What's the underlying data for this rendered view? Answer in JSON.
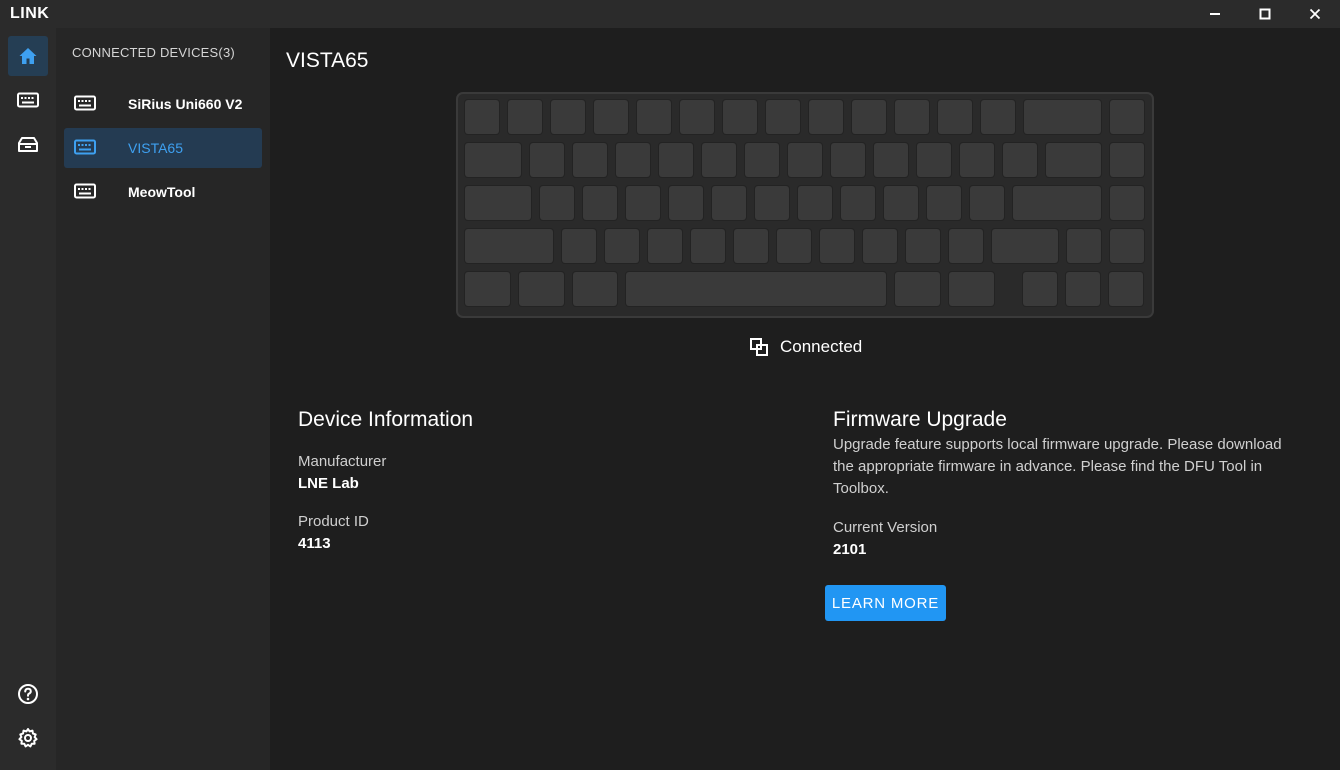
{
  "app": {
    "title": "LINK",
    "window_controls": [
      "minimize-icon",
      "maximize-icon",
      "close-icon"
    ]
  },
  "rail": {
    "top_items": [
      {
        "icon": "home-icon",
        "active": true
      },
      {
        "icon": "keyboard-icon",
        "active": false
      },
      {
        "icon": "toolbox-icon",
        "active": false
      }
    ],
    "bottom_items": [
      {
        "icon": "help-icon"
      },
      {
        "icon": "settings-gear-icon"
      }
    ]
  },
  "devices": {
    "header": "CONNECTED DEVICES(3)",
    "items": [
      {
        "label": "SiRius Uni660 V2",
        "icon": "keyboard-icon",
        "selected": false
      },
      {
        "label": "VISTA65",
        "icon": "keyboard-icon",
        "selected": true
      },
      {
        "label": "MeowTool",
        "icon": "keyboard-icon",
        "selected": false
      }
    ]
  },
  "main": {
    "device_title": "VISTA65",
    "status": {
      "icon": "connected-icon",
      "text": "Connected"
    },
    "device_info": {
      "title": "Device Information",
      "manufacturer_label": "Manufacturer",
      "manufacturer_value": "LNE Lab",
      "product_id_label": "Product ID",
      "product_id_value": "4113"
    },
    "firmware": {
      "title": "Firmware Upgrade",
      "description": "Upgrade feature supports local firmware upgrade. Please download the appropriate firmware in advance. Please find the DFU Tool in Toolbox.",
      "current_version_label": "Current Version",
      "current_version_value": "2101",
      "learn_more_label": "LEARN MORE"
    }
  },
  "colors": {
    "accent": "#2196f3",
    "selected_bg": "#243b52",
    "selected_text": "#3ea0f0",
    "background": "#1e1e1e"
  }
}
